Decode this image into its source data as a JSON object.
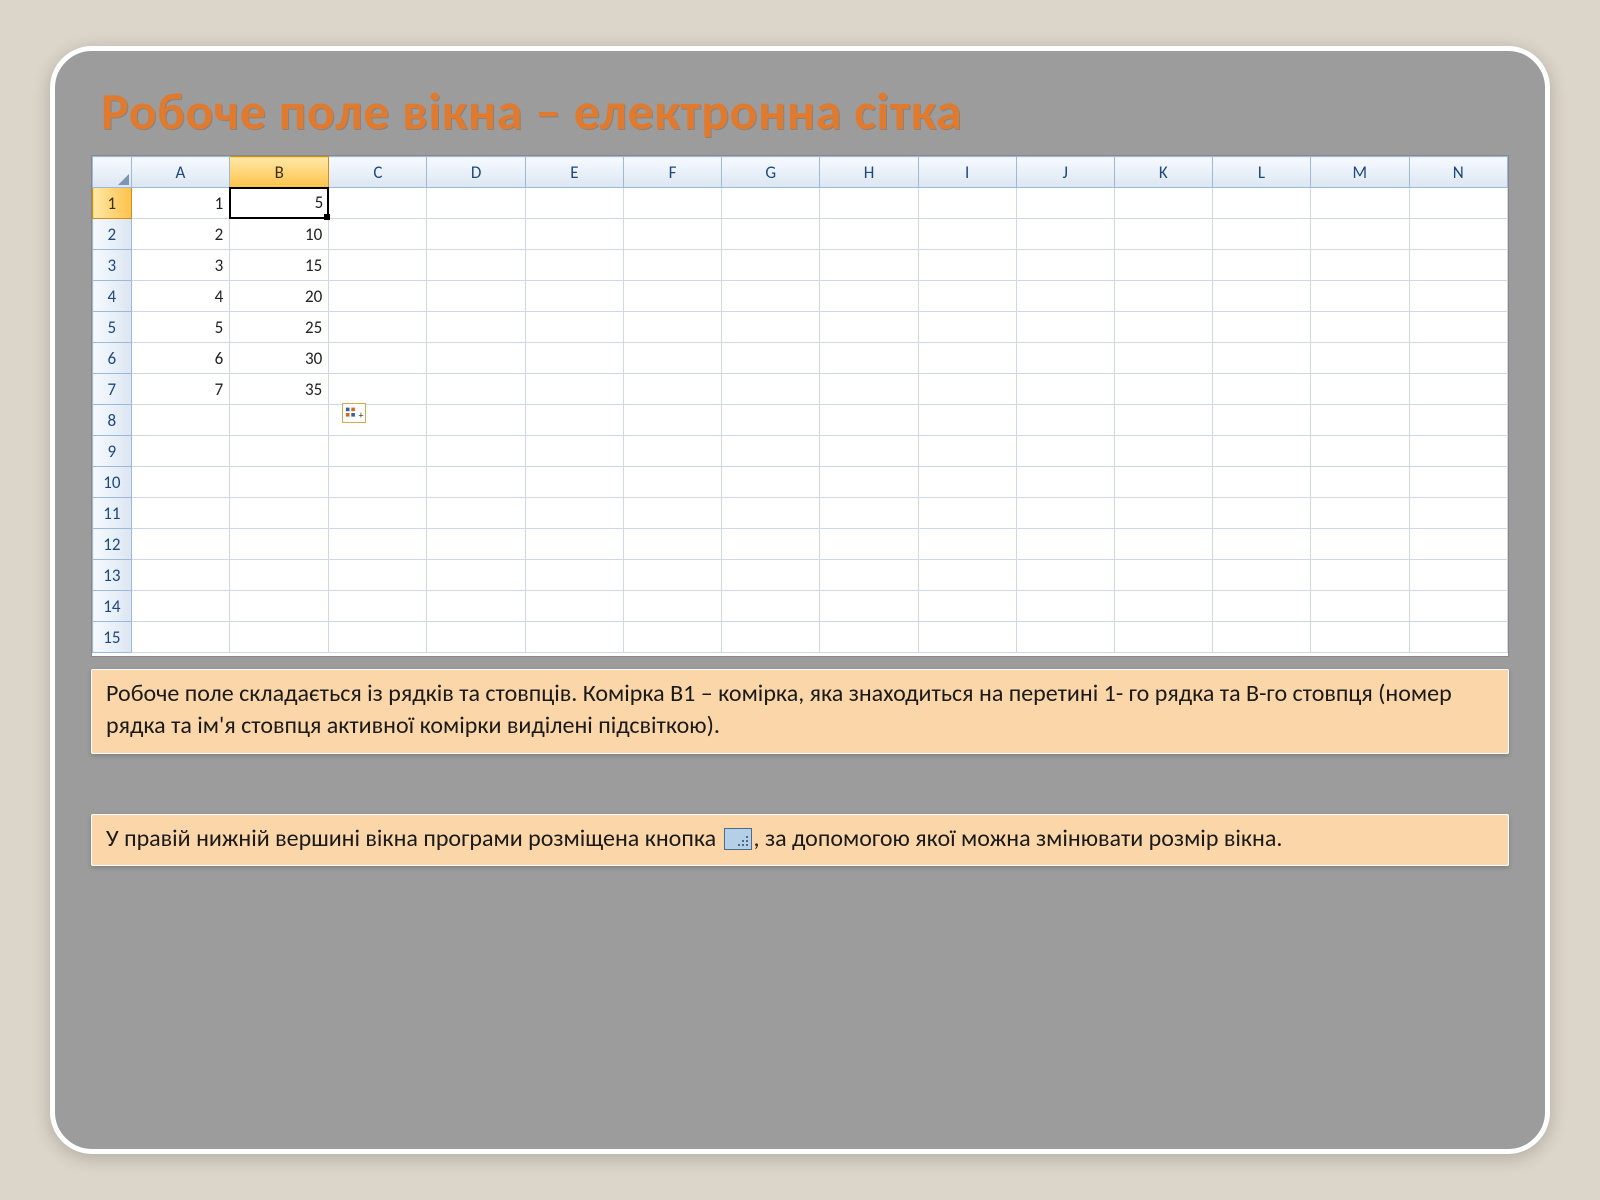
{
  "title": "Робоче поле вікна – електронна сітка",
  "columns": [
    "A",
    "B",
    "C",
    "D",
    "E",
    "F",
    "G",
    "H",
    "I",
    "J",
    "K",
    "L",
    "M",
    "N"
  ],
  "active_column_index": 1,
  "active_row_index": 0,
  "visible_rows": 15,
  "cell_data": {
    "A": [
      "1",
      "2",
      "3",
      "4",
      "5",
      "6",
      "7"
    ],
    "B": [
      "5",
      "10",
      "15",
      "20",
      "25",
      "30",
      "35"
    ]
  },
  "selected_cell": {
    "col": "B",
    "row": 1,
    "display": "5"
  },
  "autofill_icon_near": {
    "col_after": "B",
    "row": 8
  },
  "textbox1": "Робоче поле складається із рядків та стовпців. Комірка В1 – комірка, яка знаходиться на перетині 1- го рядка та В-го стовпця (номер рядка та ім'я стовпця активної комірки виділені підсвіткою).",
  "textbox2_before": "У правій нижній вершині вікна програми розміщена кнопка ",
  "textbox2_after": ", за допомогою якої можна змінювати розмір вікна."
}
